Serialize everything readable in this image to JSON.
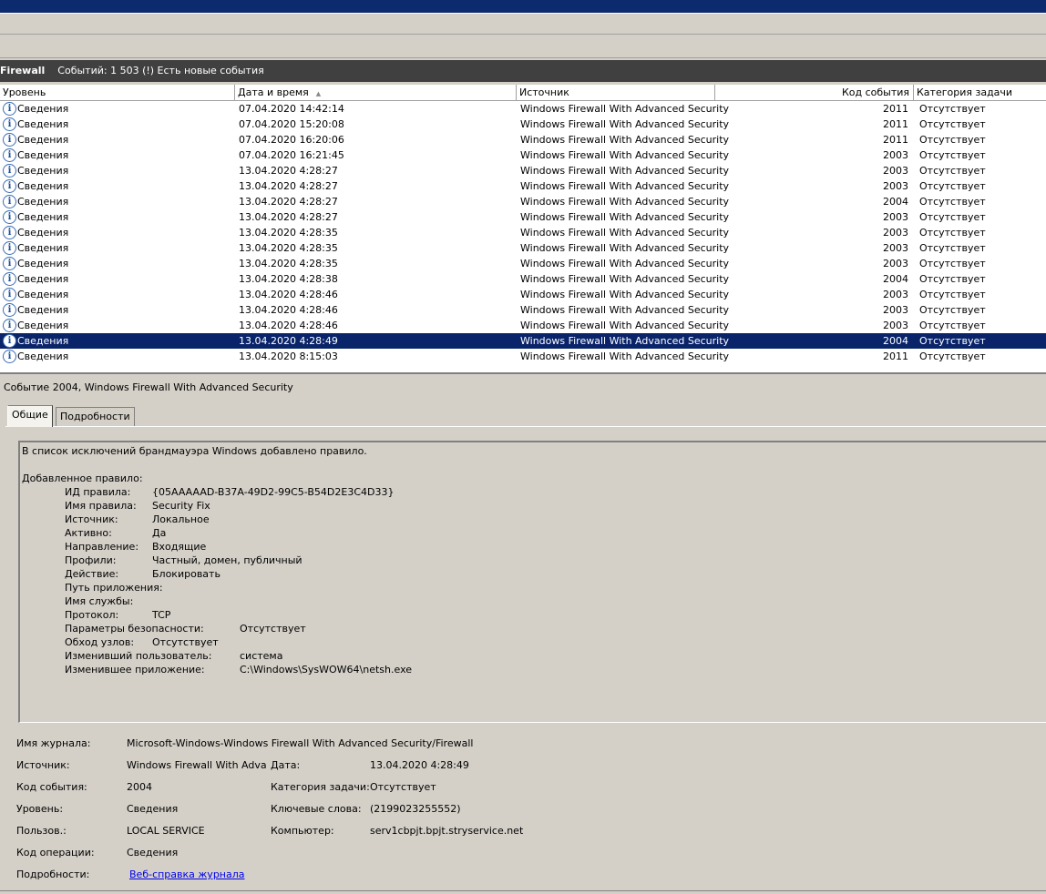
{
  "logbar": {
    "name": "Firewall",
    "summary": "Событий: 1 503 (!) Есть новые события"
  },
  "columns": [
    "Уровень",
    "Дата и время",
    "Источник",
    "Код события",
    "Категория задачи"
  ],
  "rows": [
    {
      "level": "Сведения",
      "date": "07.04.2020 14:42:14",
      "source": "Windows Firewall With Advanced Security",
      "code": "2011",
      "category": "Отсутствует"
    },
    {
      "level": "Сведения",
      "date": "07.04.2020 15:20:08",
      "source": "Windows Firewall With Advanced Security",
      "code": "2011",
      "category": "Отсутствует"
    },
    {
      "level": "Сведения",
      "date": "07.04.2020 16:20:06",
      "source": "Windows Firewall With Advanced Security",
      "code": "2011",
      "category": "Отсутствует"
    },
    {
      "level": "Сведения",
      "date": "07.04.2020 16:21:45",
      "source": "Windows Firewall With Advanced Security",
      "code": "2003",
      "category": "Отсутствует"
    },
    {
      "level": "Сведения",
      "date": "13.04.2020 4:28:27",
      "source": "Windows Firewall With Advanced Security",
      "code": "2003",
      "category": "Отсутствует"
    },
    {
      "level": "Сведения",
      "date": "13.04.2020 4:28:27",
      "source": "Windows Firewall With Advanced Security",
      "code": "2003",
      "category": "Отсутствует"
    },
    {
      "level": "Сведения",
      "date": "13.04.2020 4:28:27",
      "source": "Windows Firewall With Advanced Security",
      "code": "2004",
      "category": "Отсутствует"
    },
    {
      "level": "Сведения",
      "date": "13.04.2020 4:28:27",
      "source": "Windows Firewall With Advanced Security",
      "code": "2003",
      "category": "Отсутствует"
    },
    {
      "level": "Сведения",
      "date": "13.04.2020 4:28:35",
      "source": "Windows Firewall With Advanced Security",
      "code": "2003",
      "category": "Отсутствует"
    },
    {
      "level": "Сведения",
      "date": "13.04.2020 4:28:35",
      "source": "Windows Firewall With Advanced Security",
      "code": "2003",
      "category": "Отсутствует"
    },
    {
      "level": "Сведения",
      "date": "13.04.2020 4:28:35",
      "source": "Windows Firewall With Advanced Security",
      "code": "2003",
      "category": "Отсутствует"
    },
    {
      "level": "Сведения",
      "date": "13.04.2020 4:28:38",
      "source": "Windows Firewall With Advanced Security",
      "code": "2004",
      "category": "Отсутствует"
    },
    {
      "level": "Сведения",
      "date": "13.04.2020 4:28:46",
      "source": "Windows Firewall With Advanced Security",
      "code": "2003",
      "category": "Отсутствует"
    },
    {
      "level": "Сведения",
      "date": "13.04.2020 4:28:46",
      "source": "Windows Firewall With Advanced Security",
      "code": "2003",
      "category": "Отсутствует"
    },
    {
      "level": "Сведения",
      "date": "13.04.2020 4:28:46",
      "source": "Windows Firewall With Advanced Security",
      "code": "2003",
      "category": "Отсутствует"
    },
    {
      "level": "Сведения",
      "date": "13.04.2020 4:28:49",
      "source": "Windows Firewall With Advanced Security",
      "code": "2004",
      "category": "Отсутствует",
      "selected": true
    },
    {
      "level": "Сведения",
      "date": "13.04.2020 8:15:03",
      "source": "Windows Firewall With Advanced Security",
      "code": "2011",
      "category": "Отсутствует"
    }
  ],
  "event_title": "Событие 2004, Windows Firewall With Advanced Security",
  "tabs": {
    "general": "Общие",
    "details": "Подробности"
  },
  "description": {
    "intro": "В список исключений брандмауэра Windows добавлено правило.",
    "added_label": "Добавленное правило:",
    "fields": [
      {
        "label": "ИД правила:",
        "value": "{05AAAAAD-B37A-49D2-99C5-B54D2E3C4D33}"
      },
      {
        "label": "Имя правила:",
        "value": "Security Fix"
      },
      {
        "label": "Источник:",
        "value": "Локальное"
      },
      {
        "label": "Активно:",
        "value": "Да"
      },
      {
        "label": "Направление:",
        "value": "Входящие"
      },
      {
        "label": "Профили:",
        "value": "Частный, домен, публичный"
      },
      {
        "label": "Действие:",
        "value": "Блокировать"
      },
      {
        "label": "Путь приложения:",
        "value": ""
      },
      {
        "label": "Имя службы:",
        "value": ""
      },
      {
        "label": "Протокол:",
        "value": "TCP"
      },
      {
        "label": "Параметры безопасности:",
        "value": "Отсутствует"
      },
      {
        "label": "Обход узлов:",
        "value": "Отсутствует"
      },
      {
        "label": "Изменивший пользователь:",
        "value": "система"
      },
      {
        "label": "Изменившее приложение:",
        "value": "C:\\Windows\\SysWOW64\\netsh.exe"
      }
    ]
  },
  "meta": {
    "log_name_label": "Имя журнала:",
    "log_name": "Microsoft-Windows-Windows Firewall With Advanced Security/Firewall",
    "source_label": "Источник:",
    "source": "Windows Firewall With Adva",
    "date_label": "Дата:",
    "date": "13.04.2020 4:28:49",
    "code_label": "Код события:",
    "code": "2004",
    "category_label": "Категория задачи:",
    "category": "Отсутствует",
    "level_label": "Уровень:",
    "level": "Сведения",
    "keywords_label": "Ключевые слова:",
    "keywords": "(2199023255552)",
    "user_label": "Пользов.:",
    "user": "LOCAL SERVICE",
    "computer_label": "Компьютер:",
    "computer": "serv1cbpjt.bpjt.stryservice.net",
    "opcode_label": "Код операции:",
    "opcode": "Сведения",
    "details_label": "Подробности:",
    "details_link": "Веб-справка журнала"
  }
}
